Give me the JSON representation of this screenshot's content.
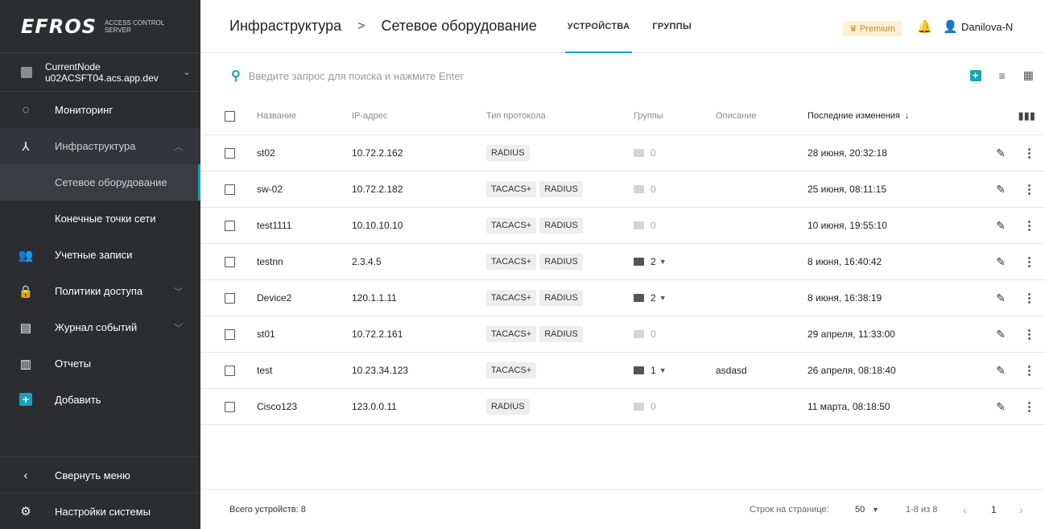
{
  "logo": {
    "mark": "EFROS",
    "sub1": "ACCESS CONTROL",
    "sub2": "SERVER"
  },
  "node": {
    "name": "CurrentNode",
    "host": "u02ACSFT04.acs.app.dev"
  },
  "sidebar": {
    "items": [
      {
        "label": "Мониторинг"
      },
      {
        "label": "Инфраструктура"
      },
      {
        "label": "Сетевое оборудование"
      },
      {
        "label": "Конечные точки сети"
      },
      {
        "label": "Учетные записи"
      },
      {
        "label": "Политики доступа"
      },
      {
        "label": "Журнал событий"
      },
      {
        "label": "Отчеты"
      },
      {
        "label": "Добавить"
      }
    ],
    "collapse_label": "Свернуть меню",
    "settings_label": "Настройки системы"
  },
  "header": {
    "crumb1": "Инфраструктура",
    "separator": ">",
    "crumb2": "Сетевое оборудование",
    "tabs": [
      {
        "label": "УСТРОЙСТВА"
      },
      {
        "label": "ГРУППЫ"
      }
    ],
    "premium": "♛ Premium",
    "user": "Danilova-N"
  },
  "search": {
    "placeholder": "Введите запрос для поиска и нажмите Enter"
  },
  "table": {
    "columns": {
      "name": "Название",
      "ip": "IP-адрес",
      "protocol": "Тип протокола",
      "groups": "Группы",
      "description": "Описание",
      "modified": "Последние изменения"
    },
    "rows": [
      {
        "name": "st02",
        "ip": "10.72.2.162",
        "p1": "RADIUS",
        "p2": "",
        "groups": "0",
        "desc": "",
        "date": "28 июня, 20:32:18"
      },
      {
        "name": "sw-02",
        "ip": "10.72.2.182",
        "p1": "TACACS+",
        "p2": "RADIUS",
        "groups": "0",
        "desc": "",
        "date": "25 июня, 08:11:15"
      },
      {
        "name": "test1111",
        "ip": "10.10.10.10",
        "p1": "TACACS+",
        "p2": "RADIUS",
        "groups": "0",
        "desc": "",
        "date": "10 июня, 19:55:10"
      },
      {
        "name": "testnn",
        "ip": "2.3.4.5",
        "p1": "TACACS+",
        "p2": "RADIUS",
        "groups": "2",
        "desc": "",
        "date": "8 июня, 16:40:42"
      },
      {
        "name": "Device2",
        "ip": "120.1.1.11",
        "p1": "TACACS+",
        "p2": "RADIUS",
        "groups": "2",
        "desc": "",
        "date": "8 июня, 16:38:19"
      },
      {
        "name": "st01",
        "ip": "10.72.2.161",
        "p1": "TACACS+",
        "p2": "RADIUS",
        "groups": "0",
        "desc": "",
        "date": "29 апреля, 11:33:00"
      },
      {
        "name": "test",
        "ip": "10.23.34.123",
        "p1": "TACACS+",
        "p2": "",
        "groups": "1",
        "desc": "asdasd",
        "date": "26 апреля, 08:18:40"
      },
      {
        "name": "Cisco123",
        "ip": "123.0.0.11",
        "p1": "RADIUS",
        "p2": "",
        "groups": "0",
        "desc": "",
        "date": "11 марта, 08:18:50"
      }
    ]
  },
  "footer": {
    "total": "Всего устройств: 8",
    "per_page_label": "Строк на странице:",
    "per_page_value": "50",
    "range": "1-8 из 8",
    "page": "1"
  },
  "colors": {
    "accent": "#1aa3b5",
    "sidebar_bg": "#2b2d30",
    "premium_bg": "#fdf0d6"
  }
}
